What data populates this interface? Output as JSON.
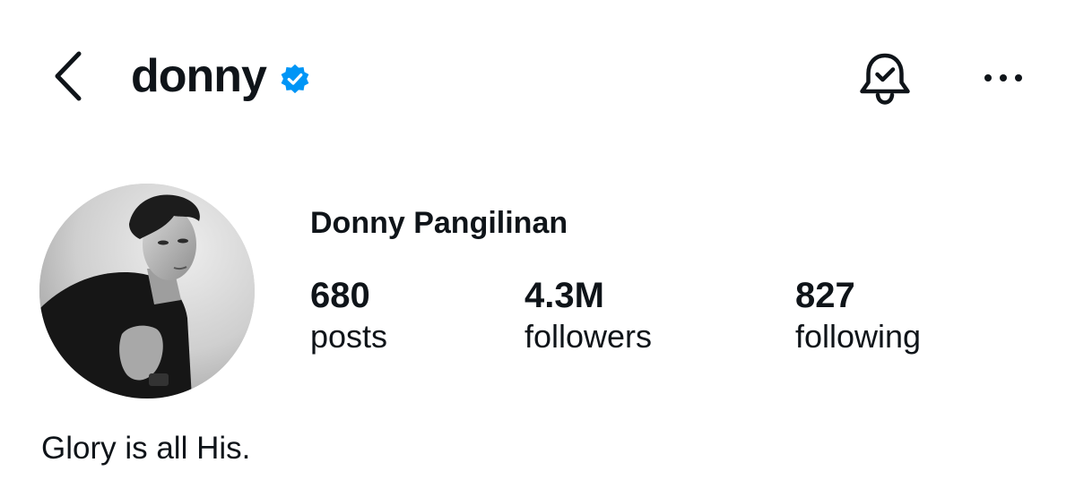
{
  "header": {
    "username": "donny",
    "back_icon": "chevron-left-icon",
    "verified_icon": "verified-badge-icon",
    "notification_icon": "bell-check-icon",
    "more_icon": "ellipsis-icon"
  },
  "profile": {
    "display_name": "Donny Pangilinan",
    "stats": [
      {
        "value": "680",
        "label": "posts"
      },
      {
        "value": "4.3M",
        "label": "followers"
      },
      {
        "value": "827",
        "label": "following"
      }
    ],
    "bio": "Glory is all His."
  },
  "colors": {
    "verified_blue": "#0095f6",
    "text": "#0f1419",
    "background": "#ffffff"
  }
}
